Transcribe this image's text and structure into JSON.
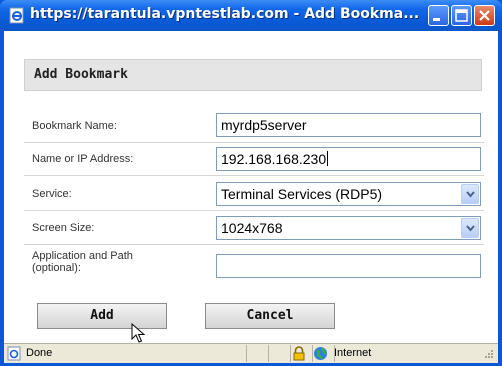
{
  "window": {
    "title": "https://tarantula.vpntestlab.com - Add Bookma..."
  },
  "form": {
    "header": "Add Bookmark",
    "bookmark_name_label": "Bookmark Name:",
    "bookmark_name_value": "myrdp5server",
    "address_label": "Name or IP Address:",
    "address_value": "192.168.168.230",
    "service_label": "Service:",
    "service_value": "Terminal Services (RDP5)",
    "screen_size_label": "Screen Size:",
    "screen_size_value": "1024x768",
    "app_path_label_line1": "Application and Path",
    "app_path_label_line2": "(optional):",
    "app_path_value": ""
  },
  "buttons": {
    "add": "Add",
    "cancel": "Cancel"
  },
  "statusbar": {
    "status": "Done",
    "zone": "Internet"
  },
  "colors": {
    "titlebar": "#0a5ad6",
    "header_bg": "#e5e5e5",
    "statusbar_bg": "#ece9d8"
  }
}
